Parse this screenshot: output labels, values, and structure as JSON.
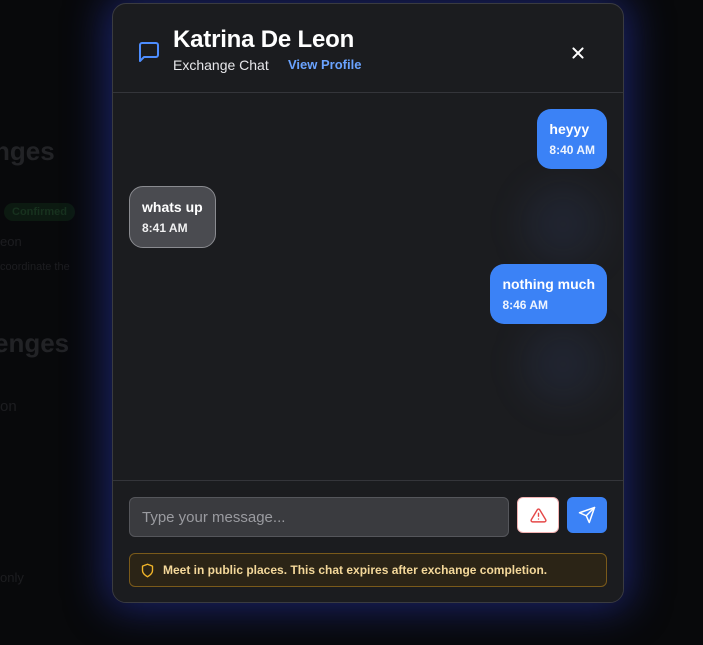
{
  "background_page": {
    "heading_1": "nges",
    "heading_2": "enges",
    "badge": "Confirmed",
    "line_1": "eon",
    "line_2": "coordinate the",
    "line_3": "on",
    "line_4": "only"
  },
  "chat": {
    "name": "Katrina De Leon",
    "subtitle": "Exchange Chat",
    "view_profile": "View Profile",
    "close_icon": "close-icon",
    "messages": [
      {
        "direction": "out",
        "text": "heyyy",
        "time": "8:40 AM"
      },
      {
        "direction": "in",
        "text": "whats up",
        "time": "8:41 AM"
      },
      {
        "direction": "out",
        "text": "nothing much",
        "time": "8:46 AM"
      }
    ],
    "input": {
      "placeholder": "Type your message...",
      "value": ""
    },
    "report_icon": "warning-icon",
    "send_icon": "send-icon",
    "notice": "Meet in public places. This chat expires after exchange completion."
  },
  "colors": {
    "accent": "#3b82f6",
    "link": "#6aa3ff",
    "notice_text": "#f4d89a",
    "notice_border": "#7a5a1a",
    "danger": "#e54848"
  }
}
